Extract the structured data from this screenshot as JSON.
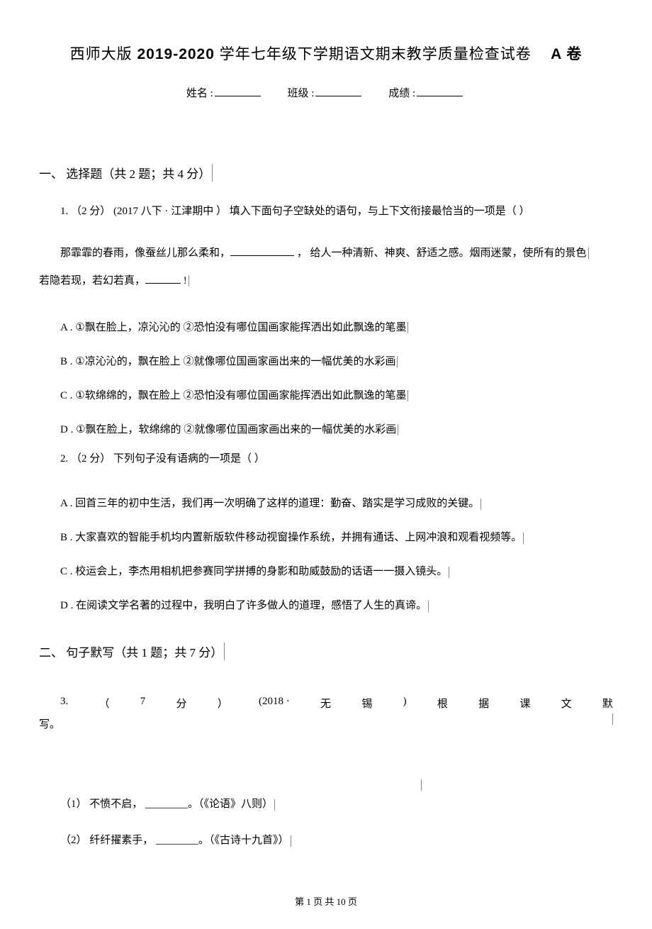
{
  "title_prefix": "西师大版",
  "title_year": "2019-2020",
  "title_rest": "学年七年级下学期语文期末教学质量检查试卷",
  "title_suffix": "A 卷",
  "info": {
    "name_label": "姓名 :",
    "class_label": "班级 :",
    "score_label": "成绩 :"
  },
  "section1": {
    "heading": "一、  选择题（共 2 题；共 4 分）",
    "q1": {
      "number": "1.  （2 分） (2017  八下 · 江津期中  ）",
      "stem": "填入下面句子空缺处的语句，与上下文衔接最恰当的一项是（            ）",
      "passage_a": "那霏霏的春雨，像蚕丝儿那么柔和，",
      "passage_b": "，  给人一种清新、神爽、舒适之感。烟雨迷蒙，使所有的景色",
      "passage_c": "若隐若现，若幻若真，",
      "passage_d": "!",
      "A": "A .  ①飘在脸上，凉沁沁的      ②恐怕没有哪位国画家能挥洒出如此飘逸的笔墨",
      "B": "B .  ①凉沁沁的，飘在脸上      ②就像哪位国画家画出来的一幅优美的水彩画",
      "C": "C .  ①软绵绵的，飘在脸上      ②恐怕没有哪位国画家能挥洒出如此飘逸的笔墨",
      "D": "D .  ①飘在脸上，软绵绵的      ②就像哪位国画家画出来的一幅优美的水彩画"
    },
    "q2": {
      "number": "2.  （2 分）",
      "stem": "下列句子没有语病的一项是（          ）",
      "A": "A .  回首三年的初中生活，我们再一次明确了这样的道理：勤奋、踏实是学习成败的关键。",
      "B": "B .  大家喜欢的智能手机均内置新版软件移动视窗操作系统，并拥有通话、上网冲浪和观看视频等。",
      "C": "C .  校运会上，李杰用相机把参赛同学拼搏的身影和助威鼓励的话语一一摄入镜头。",
      "D": "D .  在阅读文学名著的过程中，我明白了许多做人的道理，感悟了人生的真谛。"
    }
  },
  "section2": {
    "heading": "二、  句子默写（共 1 题；共 7 分）",
    "q3": {
      "parts": [
        "3.",
        "（",
        "7",
        "分",
        "）",
        "(2018 ·",
        "无",
        "锡",
        ")",
        "根",
        "据",
        "课",
        "文",
        "默"
      ],
      "tail": "写。",
      "sub1": "（1）  不愤不启，  ________。（《论语》八则）",
      "sub2": "（2）  纤纤擢素手，  ________。（《古诗十九首》）"
    }
  },
  "footer": "第  1  页 共  10  页"
}
